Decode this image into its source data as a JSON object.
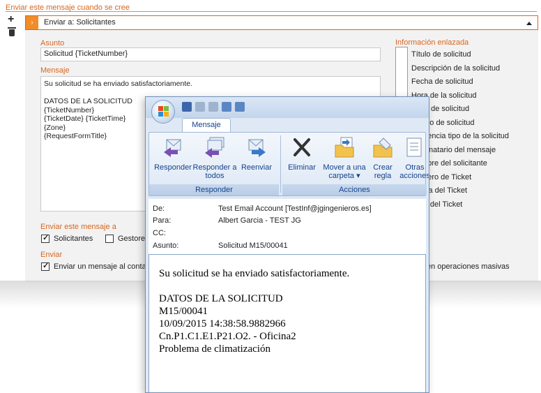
{
  "panel": {
    "section_title": "Enviar este mensaje cuando se cree",
    "send_to_value": "Enviar a: Solicitantes",
    "subject_label": "Asunto",
    "subject_value": "Solicitud {TicketNumber}",
    "message_label": "Mensaje",
    "message_lines": [
      "Su solicitud se ha enviado satisfactoriamente.",
      "",
      "DATOS DE LA SOLICITUD",
      "{TicketNumber}",
      "{TicketDate} {TicketTime}",
      "{Zone}",
      "{RequestFormTitle}"
    ],
    "linked_label": "Información enlazada",
    "linked_items": [
      "Título de solicitud",
      "Descripción de la solicitud",
      "Fecha de solicitud",
      "Hora de la solicitud",
      "Zona de solicitud",
      "Motivo de solicitud",
      "Incidencia tipo de la solicitud",
      "Destinatario del mensaje",
      "Nombre del solicitante",
      "Número de Ticket",
      "Fecha del Ticket",
      "Hora del Ticket"
    ],
    "send_message_to_label": "Enviar este mensaje a",
    "recipients": [
      {
        "label": "Solicitantes",
        "checked": true
      },
      {
        "label": "Gestores",
        "checked": false
      }
    ],
    "send_label": "Enviar",
    "send_option_left": "Enviar un mensaje al contac",
    "send_option_right": "en operaciones masivas"
  },
  "outlook": {
    "tab_label": "Mensaje",
    "groups": [
      {
        "label": "Responder",
        "buttons": [
          "Responder",
          "Responder a todos",
          "Reenviar"
        ]
      },
      {
        "label": "Acciones",
        "buttons": [
          "Eliminar",
          "Mover a una carpeta ▾",
          "Crear regla",
          "Otras acciones"
        ]
      }
    ],
    "headers": {
      "from_label": "De:",
      "from_value": "Test Email Account [TestInf@jgingenieros.es]",
      "to_label": "Para:",
      "to_value": "Albert Garcia - TEST JG",
      "cc_label": "CC:",
      "cc_value": "",
      "subject_label": "Asunto:",
      "subject_value": "Solicitud M15/00041"
    },
    "body_lines": [
      "Su solicitud se ha enviado satisfactoriamente.",
      "",
      "DATOS DE LA SOLICITUD",
      "M15/00041",
      "10/09/2015 14:38:58.9882966",
      "Cn.P1.C1.E1.P21.O2. - Oficina2",
      "Problema de climatización"
    ]
  },
  "colors": {
    "accent_orange": "#d9661f",
    "ribbon_text": "#15428b"
  }
}
